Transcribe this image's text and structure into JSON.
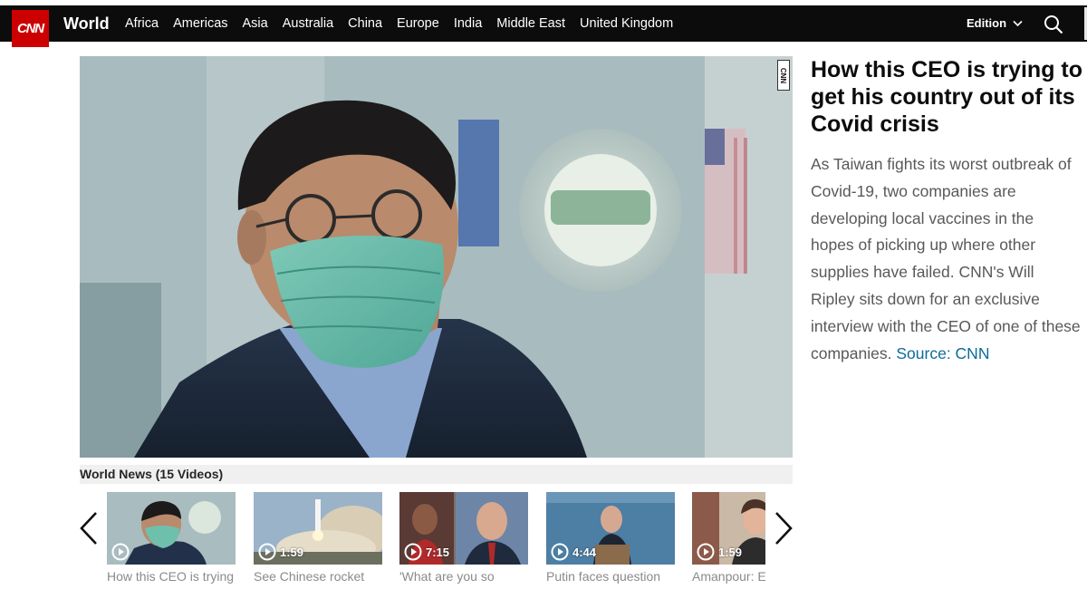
{
  "header": {
    "logo_text": "CNN",
    "section": "World",
    "nav": [
      "Africa",
      "Americas",
      "Asia",
      "Australia",
      "China",
      "Europe",
      "India",
      "Middle East",
      "United Kingdom"
    ],
    "edition_label": "Edition",
    "search_icon": "search-icon"
  },
  "hero": {
    "watermark": "CNN"
  },
  "article": {
    "headline": "How this CEO is trying to get his country out of its Covid crisis",
    "description": "As Taiwan fights its worst outbreak of Covid-19, two companies are developing local vaccines in the hopes of picking up where other supplies have failed. CNN's Will Ripley sits down for an exclusive interview with the CEO of one of these companies.",
    "source_link": "Source: CNN"
  },
  "playlist": {
    "title": "World News (15 Videos)",
    "items": [
      {
        "duration": "",
        "caption": "How this CEO is trying"
      },
      {
        "duration": "1:59",
        "caption": "See Chinese rocket"
      },
      {
        "duration": "7:15",
        "caption": "'What are you so"
      },
      {
        "duration": "4:44",
        "caption": "Putin faces question"
      },
      {
        "duration": "1:59",
        "caption": "Amanpour: E"
      }
    ]
  },
  "colors": {
    "brand_red": "#cc0000",
    "nav_bg": "#0c0c0c",
    "link_blue": "#0c6b98"
  }
}
